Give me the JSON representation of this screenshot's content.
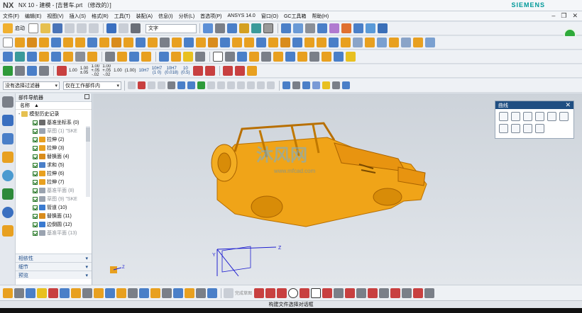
{
  "window": {
    "logo": "NX",
    "title": "NX 10 - 建模 - [吉普车.prt （修改的）]",
    "brand": "SIEMENS"
  },
  "menu": [
    "文件(F)",
    "编辑(E)",
    "视图(V)",
    "插入(S)",
    "格式(R)",
    "工具(T)",
    "装配(A)",
    "信息(I)",
    "分析(L)",
    "首选项(P)",
    "ANSYS 14.0",
    "窗口(O)",
    "GC工具箱",
    "帮助(H)"
  ],
  "toolbar1": {
    "start_label": "启动",
    "text_field": "文字"
  },
  "toolbar3": {
    "numbers": [
      "1.00",
      "1.00\n±.05",
      "1.00\n+.05\n-.02",
      "1.00\n+.05\n-.02",
      "1.00",
      "(1.00)",
      "10H7",
      "10H7\n(1 0)",
      "10H7\n(0.018)",
      "10\n(0.5)"
    ]
  },
  "toolbar4": {
    "filter": "没有选择过滤器",
    "scope": "仅在工作部件内"
  },
  "navigator": {
    "title": "部件导航器",
    "column": "名称",
    "root": "模型历史记录",
    "items": [
      {
        "label": "基准坐标系 (0)",
        "grey": false,
        "color": "#6a6a6a"
      },
      {
        "label": "草图 (1) \"SKE",
        "grey": true,
        "color": "#9aa3b0"
      },
      {
        "label": "拉伸 (2)",
        "grey": false,
        "color": "#e8a020"
      },
      {
        "label": "拉伸 (3)",
        "grey": false,
        "color": "#e8a020"
      },
      {
        "label": "替换面 (4)",
        "grey": false,
        "color": "#d98c1c"
      },
      {
        "label": "求和 (5)",
        "grey": false,
        "color": "#4a7fc8"
      },
      {
        "label": "拉伸 (6)",
        "grey": false,
        "color": "#e8a020"
      },
      {
        "label": "拉伸 (7)",
        "grey": false,
        "color": "#e8a020"
      },
      {
        "label": "基准平面 (8)",
        "grey": true,
        "color": "#9aa3b0"
      },
      {
        "label": "草图 (9) \"SKE",
        "grey": true,
        "color": "#9aa3b0"
      },
      {
        "label": "管道 (10)",
        "grey": false,
        "color": "#3a7ad0"
      },
      {
        "label": "替换面 (11)",
        "grey": false,
        "color": "#d98c1c"
      },
      {
        "label": "边倒圆 (12)",
        "grey": false,
        "color": "#3a7ad0"
      },
      {
        "label": "基准平面 (13)",
        "grey": true,
        "color": "#9aa3b0"
      }
    ],
    "panels": [
      "相依性",
      "细节",
      "预览"
    ]
  },
  "curve_panel": {
    "title": "曲线"
  },
  "viewport": {
    "watermark": "沐风网",
    "watermark_url": "www.mfcad.com",
    "axis_z": "Z",
    "axis_y": "Y"
  },
  "bottom": {
    "dim_label": "完成草图"
  },
  "status": {
    "text": "构建文件选择对话框"
  }
}
